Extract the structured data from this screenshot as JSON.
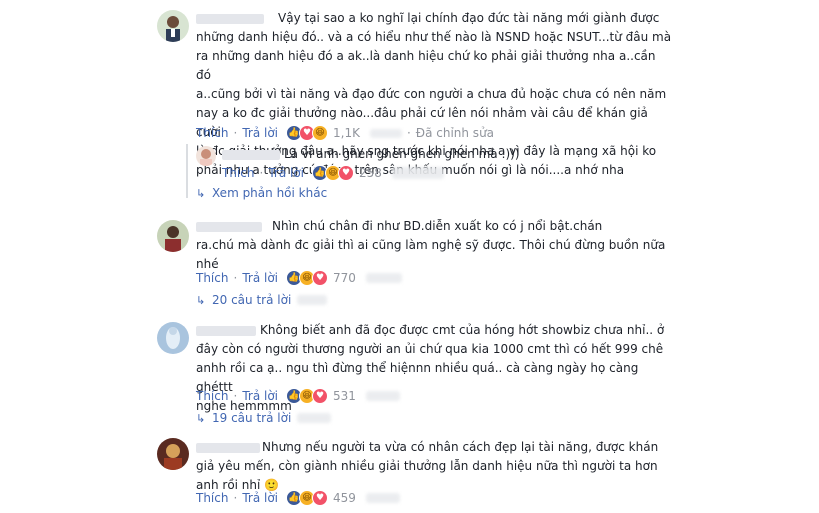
{
  "comments": [
    {
      "text": "Vậy tại sao a ko nghĩ lại chính đạo đức tài năng mới giành được\nnhững danh hiệu đó.. và a có hiểu như thế nào là NSND hoặc NSUT...từ đâu mà\nra những danh hiệu đó a ak..là danh hiệu chứ ko phải giải thưởng nha a..cần đó\na..cũng bởi vì tài năng và đạo đức con người a chưa đủ hoặc chưa có nên năm\nnay a ko đc giải thưởng nào...đâu phải cứ lên nói nhảm vài câu để khán giả cười\nlà đc giải thưởng đâu a..hãy sng trước khi nói nha a vì đây là mạng xã hội ko\nphải như a tưởng cứ đứng trên sân khấu muốn nói gì là nói....a nhớ nha",
      "like": "Thích",
      "reply": "Trả lời",
      "count": "1,1K",
      "edited": "Đã chỉnh sửa"
    },
    {
      "text": "Là vì anh ghen ghen ghen ghen mà :)))",
      "like": "Thích",
      "reply": "Trả lời",
      "count": "258"
    },
    {
      "text": "Nhìn chú chân đi như BD.diễn xuất ko có      j nổi bật.chán\nra.chú mà dành đc giải thì ai cũng làm nghệ sỹ được. Thôi chú đừng buồn nữa\nnhé",
      "like": "Thích",
      "reply": "Trả lời",
      "count": "770"
    },
    {
      "text": "Không biết anh đã đọc được cmt của hóng hớt showbiz chưa nhỉ.. ở\nđây còn có người thương người an ủi chứ qua kia 1000 cmt thì có hết 999 chê\nanhh rồi ca ạ.. ngu thì đừng thể hiệnnn nhiều quá.. cà càng ngày họ càng ghéttt\nnghe hemmmm",
      "like": "Thích",
      "reply": "Trả lời",
      "count": "531"
    },
    {
      "text": "Nhưng nếu người ta vừa có nhân cách đẹp lại tài năng, được khán\ngiả yêu mến, còn giành nhiều giải thưởng lẫn danh hiệu nữa thì người ta hơn\nanh rồi nhỉ 🙂",
      "like": "Thích",
      "reply": "Trả lời",
      "count": "459"
    }
  ],
  "more_replies": "Xem phản hồi khác",
  "reply_counts": [
    "20 câu trả lời",
    "19 câu trả lời"
  ],
  "colors": {
    "link": "#4267b2",
    "meta": "#90949c",
    "text": "#1d2129"
  }
}
